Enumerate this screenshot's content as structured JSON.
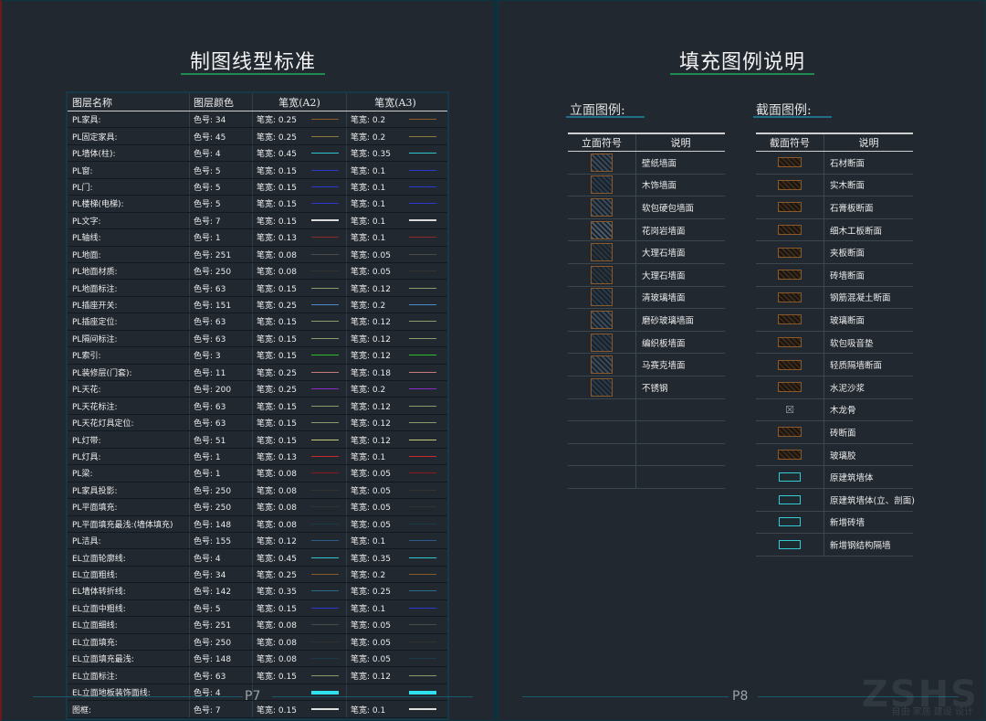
{
  "left": {
    "title": "制图线型标准",
    "page": "P7",
    "headers": [
      "图层名称",
      "图层颜色",
      "笔宽(A2)",
      "笔宽(A3)"
    ],
    "rows": [
      {
        "name": "PL家具:",
        "color": "色号: 34",
        "a2": "笔宽: 0.25",
        "a3": "笔宽: 0.2",
        "line": "#8b5a2b",
        "thick": 1
      },
      {
        "name": "PL固定家具:",
        "color": "色号: 45",
        "a2": "笔宽: 0.25",
        "a3": "笔宽: 0.2",
        "line": "#8c7a3c",
        "thick": 1
      },
      {
        "name": "PL墙体(柱):",
        "color": "色号: 4",
        "a2": "笔宽: 0.45",
        "a3": "笔宽: 0.35",
        "line": "#2fc7cf",
        "thick": 1
      },
      {
        "name": "PL窗:",
        "color": "色号: 5",
        "a2": "笔宽: 0.15",
        "a3": "笔宽: 0.1",
        "line": "#2a3ad0",
        "thick": 1
      },
      {
        "name": "PL门:",
        "color": "色号: 5",
        "a2": "笔宽: 0.15",
        "a3": "笔宽: 0.1",
        "line": "#2a3ad0",
        "thick": 1
      },
      {
        "name": "PL楼梯(电梯):",
        "color": "色号: 5",
        "a2": "笔宽: 0.15",
        "a3": "笔宽: 0.1",
        "line": "#2a3ad0",
        "thick": 1
      },
      {
        "name": "PL文字:",
        "color": "色号: 7",
        "a2": "笔宽: 0.15",
        "a3": "笔宽: 0.1",
        "line": "#d8d8d8",
        "thick": 2
      },
      {
        "name": "PL轴线:",
        "color": "色号: 1",
        "a2": "笔宽: 0.13",
        "a3": "笔宽: 0.1",
        "line": "#8a2a2a",
        "thick": 1
      },
      {
        "name": "PL地面:",
        "color": "色号: 251",
        "a2": "笔宽: 0.08",
        "a3": "笔宽: 0.05",
        "line": "#4a4a4a",
        "thick": 1
      },
      {
        "name": "PL地面材质:",
        "color": "色号: 250",
        "a2": "笔宽: 0.08",
        "a3": "笔宽: 0.05",
        "line": "#333333",
        "thick": 1
      },
      {
        "name": "PL地面标注:",
        "color": "色号: 63",
        "a2": "笔宽: 0.15",
        "a3": "笔宽: 0.12",
        "line": "#8a9a6a",
        "thick": 1
      },
      {
        "name": "PL插座开关:",
        "color": "色号: 151",
        "a2": "笔宽: 0.25",
        "a3": "笔宽: 0.2",
        "line": "#4a8ac8",
        "thick": 1
      },
      {
        "name": "PL插座定位:",
        "color": "色号: 63",
        "a2": "笔宽: 0.15",
        "a3": "笔宽: 0.12",
        "line": "#8a9a6a",
        "thick": 1
      },
      {
        "name": "PL隔间标注:",
        "color": "色号: 63",
        "a2": "笔宽: 0.15",
        "a3": "笔宽: 0.12",
        "line": "#8a9a6a",
        "thick": 1
      },
      {
        "name": "PL索引:",
        "color": "色号: 3",
        "a2": "笔宽: 0.15",
        "a3": "笔宽: 0.12",
        "line": "#2ac02a",
        "thick": 1
      },
      {
        "name": "PL装修层(门套):",
        "color": "色号: 11",
        "a2": "笔宽: 0.25",
        "a3": "笔宽: 0.18",
        "line": "#c87a7a",
        "thick": 1
      },
      {
        "name": "PL天花:",
        "color": "色号: 200",
        "a2": "笔宽: 0.25",
        "a3": "笔宽: 0.2",
        "line": "#8a2ac8",
        "thick": 1
      },
      {
        "name": "PL天花标注:",
        "color": "色号: 63",
        "a2": "笔宽: 0.15",
        "a3": "笔宽: 0.12",
        "line": "#8a9a6a",
        "thick": 1
      },
      {
        "name": "PL天花灯具定位:",
        "color": "色号: 63",
        "a2": "笔宽: 0.15",
        "a3": "笔宽: 0.12",
        "line": "#8a9a6a",
        "thick": 1
      },
      {
        "name": "PL灯带:",
        "color": "色号: 51",
        "a2": "笔宽: 0.15",
        "a3": "笔宽: 0.12",
        "line": "#c8c87a",
        "thick": 1
      },
      {
        "name": "PL灯具:",
        "color": "色号: 1",
        "a2": "笔宽: 0.13",
        "a3": "笔宽: 0.1",
        "line": "#c82a2a",
        "thick": 1
      },
      {
        "name": "PL梁:",
        "color": "色号: 1",
        "a2": "笔宽: 0.08",
        "a3": "笔宽: 0.05",
        "line": "#8a1a1a",
        "thick": 1
      },
      {
        "name": "PL家具投影:",
        "color": "色号: 250",
        "a2": "笔宽: 0.08",
        "a3": "笔宽: 0.05",
        "line": "#333333",
        "thick": 1
      },
      {
        "name": "PL平面填充:",
        "color": "色号: 250",
        "a2": "笔宽: 0.08",
        "a3": "笔宽: 0.05",
        "line": "#333333",
        "thick": 1
      },
      {
        "name": "PL平面填充最浅:(墙体填充)",
        "color": "色号: 148",
        "a2": "笔宽: 0.08",
        "a3": "笔宽: 0.05",
        "line": "#1a3a4a",
        "thick": 1
      },
      {
        "name": "PL洁具:",
        "color": "色号: 155",
        "a2": "笔宽: 0.12",
        "a3": "笔宽: 0.1",
        "line": "#2a5a8a",
        "thick": 1
      },
      {
        "name": "EL立面轮廓线:",
        "color": "色号: 4",
        "a2": "笔宽: 0.45",
        "a3": "笔宽: 0.35",
        "line": "#2fc7cf",
        "thick": 1
      },
      {
        "name": "EL立面粗线:",
        "color": "色号: 34",
        "a2": "笔宽: 0.25",
        "a3": "笔宽: 0.2",
        "line": "#8b5a2b",
        "thick": 1
      },
      {
        "name": "EL墙体转折线:",
        "color": "色号: 142",
        "a2": "笔宽: 0.35",
        "a3": "笔宽: 0.25",
        "line": "#2a6a8a",
        "thick": 1
      },
      {
        "name": "EL立面中粗线:",
        "color": "色号: 5",
        "a2": "笔宽: 0.15",
        "a3": "笔宽: 0.1",
        "line": "#2a3ad0",
        "thick": 1
      },
      {
        "name": "EL立面细线:",
        "color": "色号: 251",
        "a2": "笔宽: 0.08",
        "a3": "笔宽: 0.05",
        "line": "#4a4a4a",
        "thick": 1
      },
      {
        "name": "EL立面填充:",
        "color": "色号: 250",
        "a2": "笔宽: 0.08",
        "a3": "笔宽: 0.05",
        "line": "#333333",
        "thick": 1
      },
      {
        "name": "EL立面填充最浅:",
        "color": "色号: 148",
        "a2": "笔宽: 0.08",
        "a3": "笔宽: 0.05",
        "line": "#1a3a4a",
        "thick": 1
      },
      {
        "name": "EL立面标注:",
        "color": "色号: 63",
        "a2": "笔宽: 0.15",
        "a3": "笔宽: 0.12",
        "line": "#8a9a6a",
        "thick": 1
      },
      {
        "name": "EL立面地板装饰面线:",
        "color": "色号: 4",
        "a2": "",
        "a3": "",
        "line": "#2fe0ef",
        "thick": 4
      },
      {
        "name": "图框:",
        "color": "色号: 7",
        "a2": "笔宽: 0.15",
        "a3": "笔宽: 0.1",
        "line": "#e0e0e0",
        "thick": 2
      }
    ]
  },
  "right": {
    "title": "填充图例说明",
    "page": "P8",
    "elevation": {
      "label": "立面图例:",
      "headers": [
        "立面符号",
        "说明"
      ],
      "rows": [
        {
          "desc": "壁纸墙面",
          "fill": "#3a4a5a"
        },
        {
          "desc": "木饰墙面",
          "fill": "#2a3a4a"
        },
        {
          "desc": "软包硬包墙面",
          "fill": "#3a4a5a"
        },
        {
          "desc": "花岗岩墙面",
          "fill": "#4a5a6a"
        },
        {
          "desc": "大理石墙面",
          "fill": "#2a3540"
        },
        {
          "desc": "大理石墙面",
          "fill": "#2a3540"
        },
        {
          "desc": "清玻璃墙面",
          "fill": "#2a3a4a"
        },
        {
          "desc": "磨砂玻璃墙面",
          "fill": "#3a4a5a"
        },
        {
          "desc": "编织板墙面",
          "fill": "#2a3a4a"
        },
        {
          "desc": "马赛克墙面",
          "fill": "#3a4a5a"
        },
        {
          "desc": "不锈钢",
          "fill": "#2a3a4a"
        },
        {
          "desc": "",
          "fill": ""
        },
        {
          "desc": "",
          "fill": ""
        },
        {
          "desc": "",
          "fill": ""
        },
        {
          "desc": "",
          "fill": ""
        }
      ]
    },
    "section": {
      "label": "截面图例:",
      "headers": [
        "截面符号",
        "说明"
      ],
      "rows": [
        {
          "desc": "石材断面",
          "kind": "brown"
        },
        {
          "desc": "实木断面",
          "kind": "brown"
        },
        {
          "desc": "石膏板断面",
          "kind": "brown"
        },
        {
          "desc": "细木工板断面",
          "kind": "brown"
        },
        {
          "desc": "夹板断面",
          "kind": "brown"
        },
        {
          "desc": "砖墙断面",
          "kind": "brown"
        },
        {
          "desc": "钢筋混凝土断面",
          "kind": "brown"
        },
        {
          "desc": "玻璃断面",
          "kind": "brown"
        },
        {
          "desc": "软包吸音垫",
          "kind": "brown"
        },
        {
          "desc": "轻质隔墙断面",
          "kind": "brown"
        },
        {
          "desc": "水泥沙浆",
          "kind": "brown"
        },
        {
          "desc": "木龙骨",
          "kind": "cross"
        },
        {
          "desc": "砖断面",
          "kind": "brown"
        },
        {
          "desc": "玻璃胶",
          "kind": "brown"
        },
        {
          "desc": "原建筑墙体",
          "kind": "cyan"
        },
        {
          "desc": "原建筑墙体(立、剖面)",
          "kind": "cyan"
        },
        {
          "desc": "新增砖墙",
          "kind": "cyan"
        },
        {
          "desc": "新增钢结构隔墙",
          "kind": "cyan"
        }
      ]
    }
  },
  "watermark": "ZSHS",
  "watermark_sub": "自由 家居 建设 设计"
}
